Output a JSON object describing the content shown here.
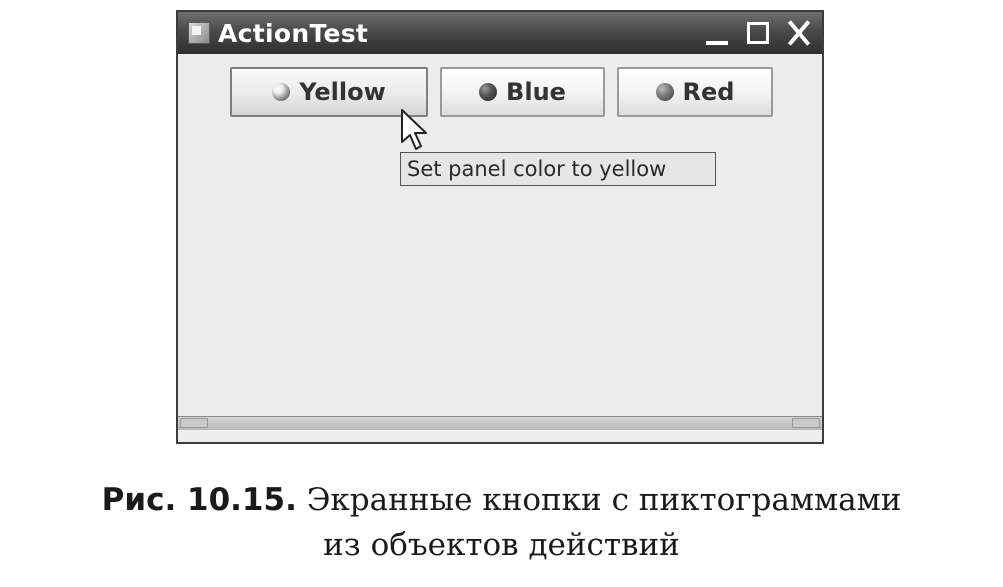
{
  "window": {
    "title": "ActionTest",
    "icon": "java-app-icon",
    "controls": [
      "minimize-icon",
      "maximize-icon",
      "close-icon"
    ]
  },
  "buttons": [
    {
      "label": "Yellow",
      "icon": "yellow-ball-icon"
    },
    {
      "label": "Blue",
      "icon": "blue-ball-icon"
    },
    {
      "label": "Red",
      "icon": "red-ball-icon"
    }
  ],
  "tooltip": {
    "text": "Set panel color to yellow"
  },
  "caption": {
    "label": "Рис. 10.15.",
    "text_line1": "Экранные кнопки с пиктограммами",
    "text_line2": "из объектов действий"
  },
  "colors": {
    "title_bar": "#3a3a3a",
    "panel_background": "#ececec",
    "tooltip_background": "#e6e6e6"
  }
}
